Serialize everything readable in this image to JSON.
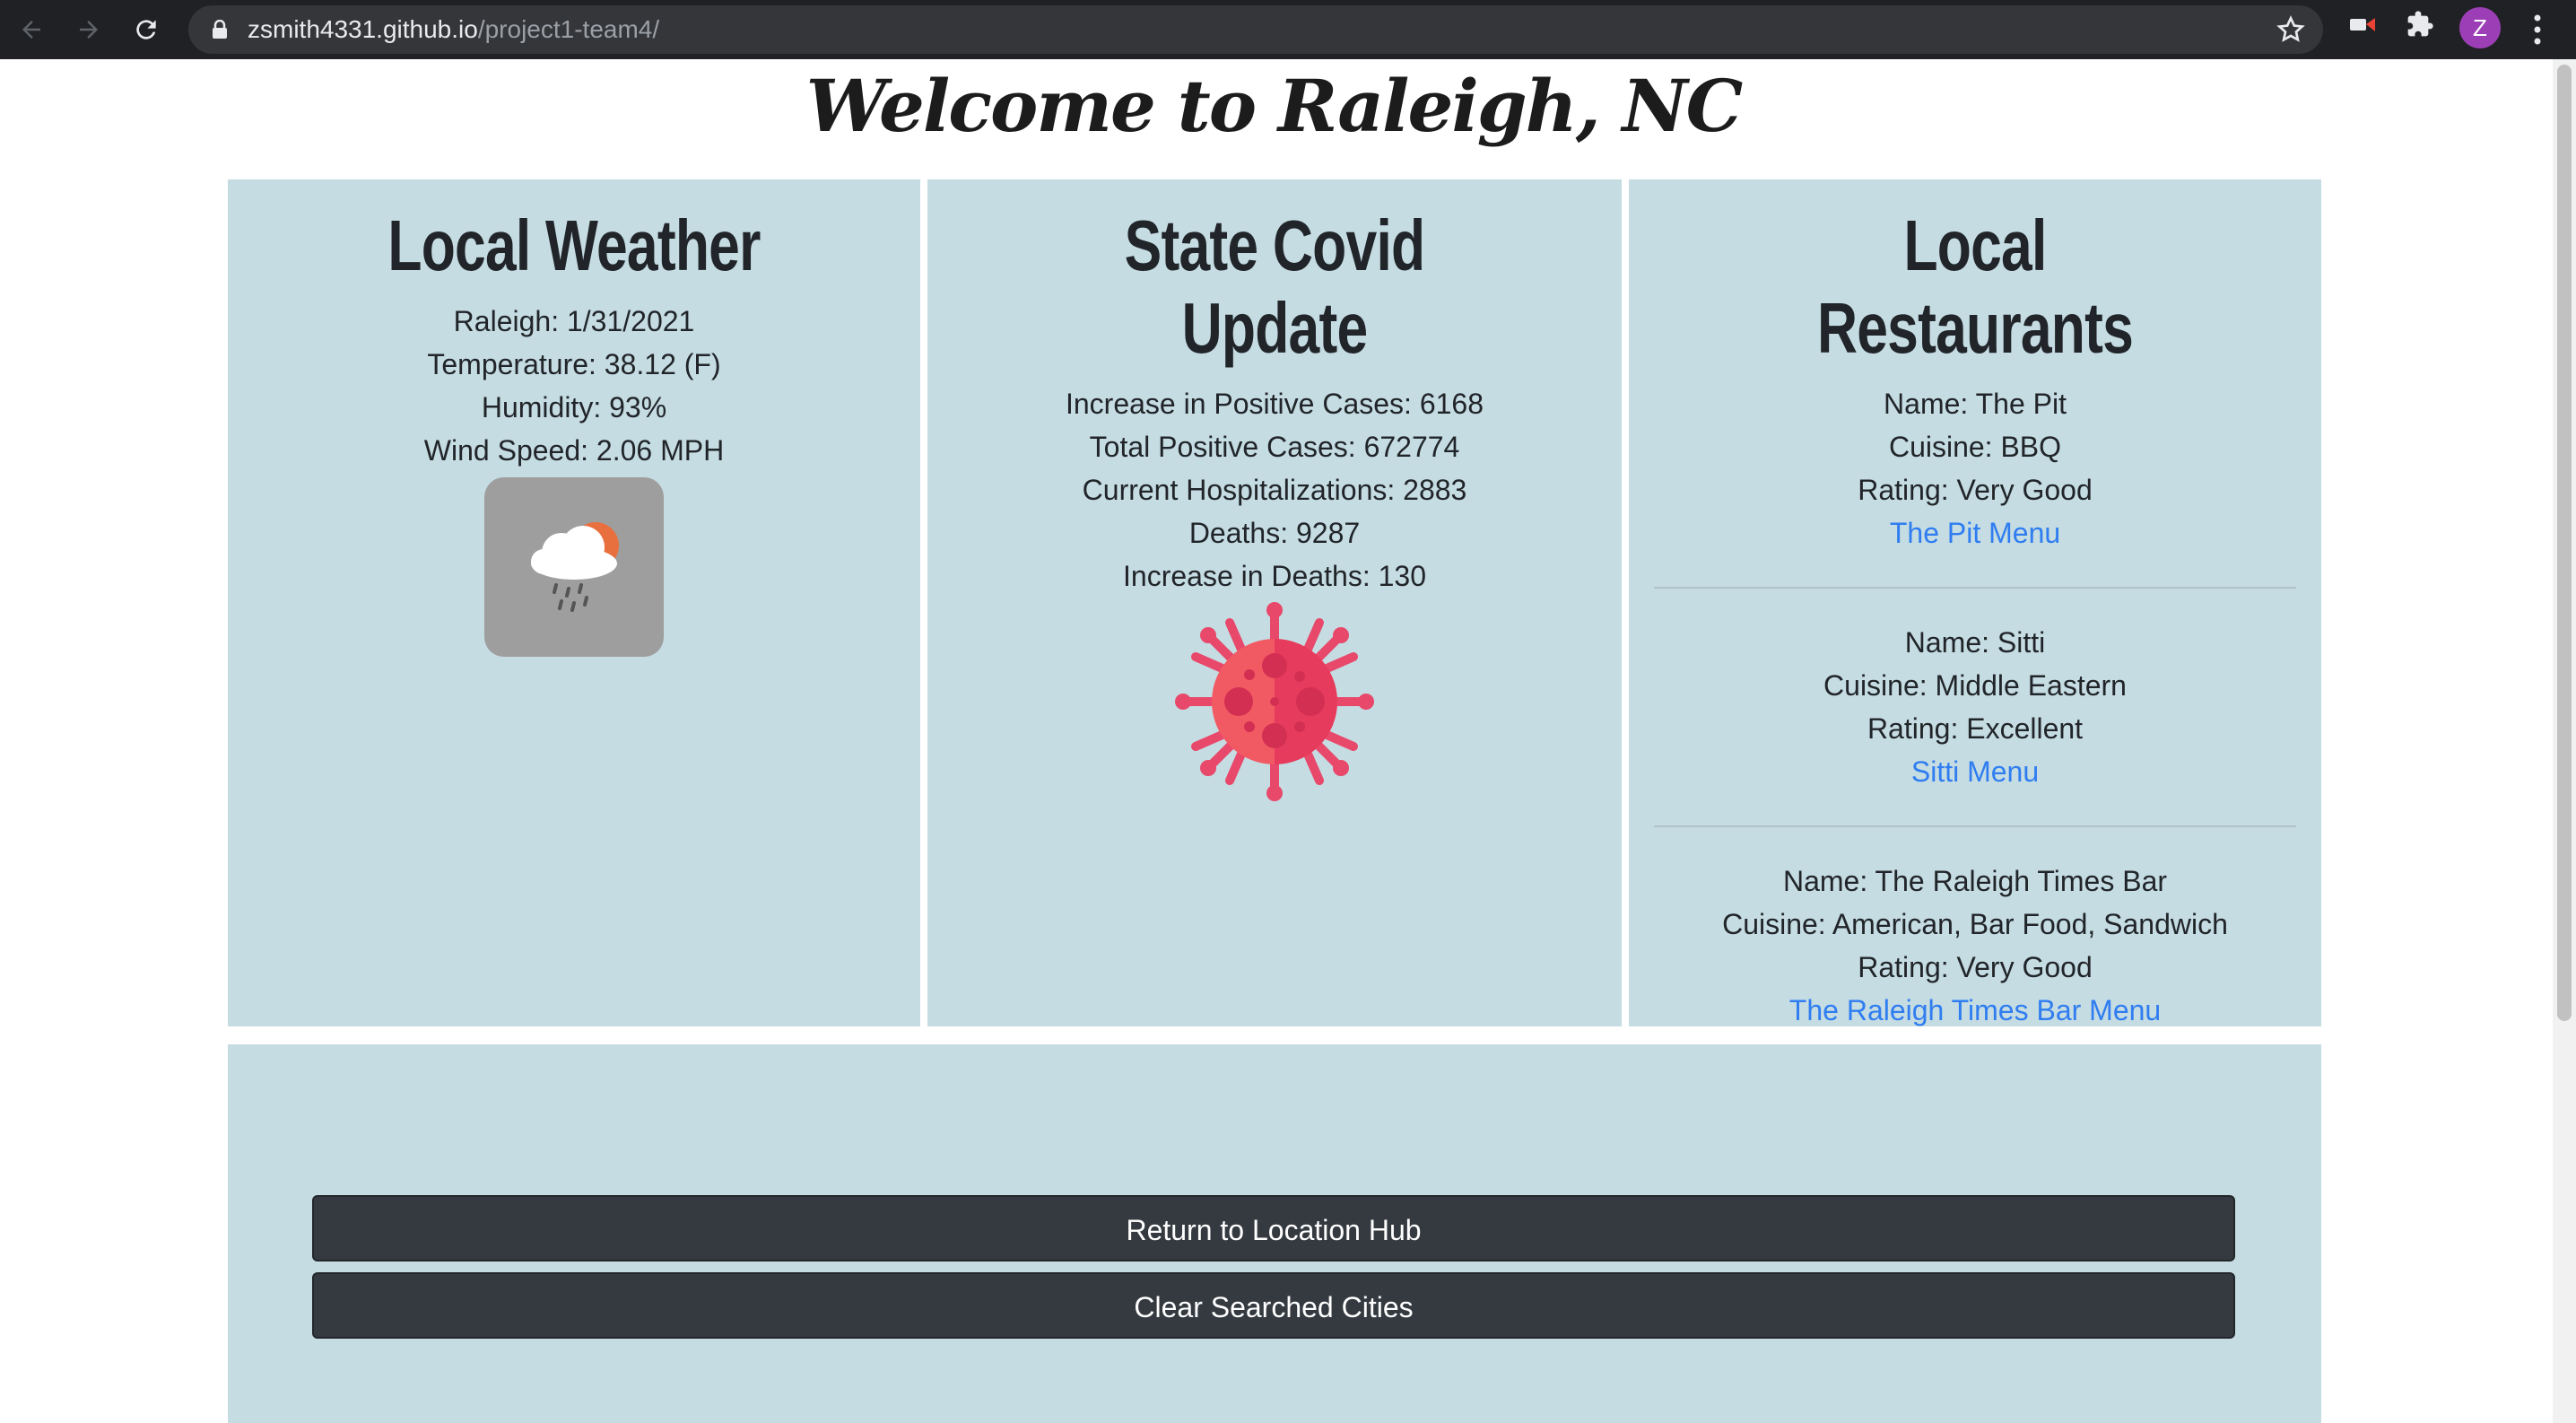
{
  "browser": {
    "url_host": "zsmith4331.github.io",
    "url_path": "/project1-team4/",
    "avatar_letter": "Z"
  },
  "page": {
    "title": "Welcome to Raleigh, NC"
  },
  "weather": {
    "heading": "Local Weather",
    "lines": [
      "Raleigh: 1/31/2021",
      "Temperature: 38.12 (F)",
      "Humidity: 93%",
      "Wind Speed: 2.06 MPH"
    ],
    "icon": "rain-cloud-sun-icon"
  },
  "covid": {
    "heading_line1": "State Covid",
    "heading_line2": "Update",
    "lines": [
      "Increase in Positive Cases: 6168",
      "Total Positive Cases: 672774",
      "Current Hospitalizations: 2883",
      "Deaths: 9287",
      "Increase in Deaths: 130"
    ],
    "icon": "virus-icon"
  },
  "restaurants": {
    "heading_line1": "Local",
    "heading_line2": "Restaurants",
    "items": [
      {
        "name": "Name: The Pit",
        "cuisine": "Cuisine: BBQ",
        "rating": "Rating: Very Good",
        "link": "The Pit Menu"
      },
      {
        "name": "Name: Sitti",
        "cuisine": "Cuisine: Middle Eastern",
        "rating": "Rating: Excellent",
        "link": "Sitti Menu"
      },
      {
        "name": "Name: The Raleigh Times Bar",
        "cuisine": "Cuisine: American, Bar Food, Sandwich",
        "rating": "Rating: Very Good",
        "link": "The Raleigh Times Bar Menu"
      }
    ]
  },
  "actions": {
    "return_label": "Return to Location Hub",
    "clear_label": "Clear Searched Cities"
  },
  "colors": {
    "card_bg": "#c5dce3",
    "link": "#2f7df0",
    "button_bg": "#343a40",
    "chrome_bg": "#202124"
  }
}
